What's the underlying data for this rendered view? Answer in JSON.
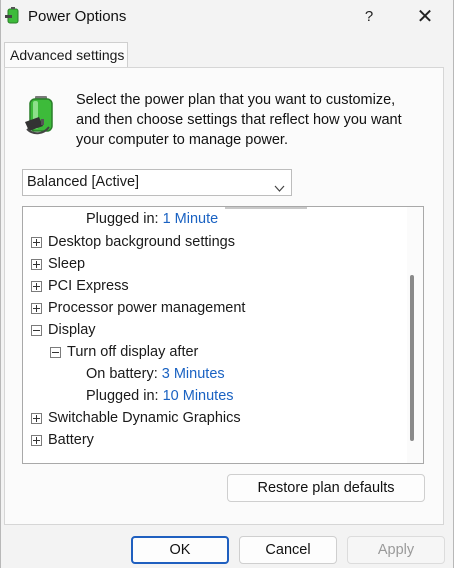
{
  "window": {
    "title": "Power Options",
    "help_label": "?",
    "close_label": "✕"
  },
  "tab": {
    "label": "Advanced settings"
  },
  "description": "Select the power plan that you want to customize, and then choose settings that reflect how you want your computer to manage power.",
  "plan_select": {
    "value": "Balanced [Active]"
  },
  "tree": {
    "rows": [
      {
        "label": "Plugged in:",
        "value": "1 Minute"
      },
      {
        "label": "Desktop background settings",
        "expander": "plus"
      },
      {
        "label": "Sleep",
        "expander": "plus"
      },
      {
        "label": "PCI Express",
        "expander": "plus"
      },
      {
        "label": "Processor power management",
        "expander": "plus"
      },
      {
        "label": "Display",
        "expander": "minus"
      },
      {
        "label": "Turn off display after",
        "expander": "minus"
      },
      {
        "label": "On battery:",
        "value": "3 Minutes"
      },
      {
        "label": "Plugged in:",
        "value": "10 Minutes"
      },
      {
        "label": "Switchable Dynamic Graphics",
        "expander": "plus"
      },
      {
        "label": "Battery",
        "expander": "plus"
      }
    ]
  },
  "buttons": {
    "restore": "Restore plan defaults",
    "ok": "OK",
    "cancel": "Cancel",
    "apply": "Apply"
  },
  "colors": {
    "value_link": "#1a62c2",
    "default_button_border": "#1f5fbf",
    "battery_green": "#3dbb3a"
  }
}
